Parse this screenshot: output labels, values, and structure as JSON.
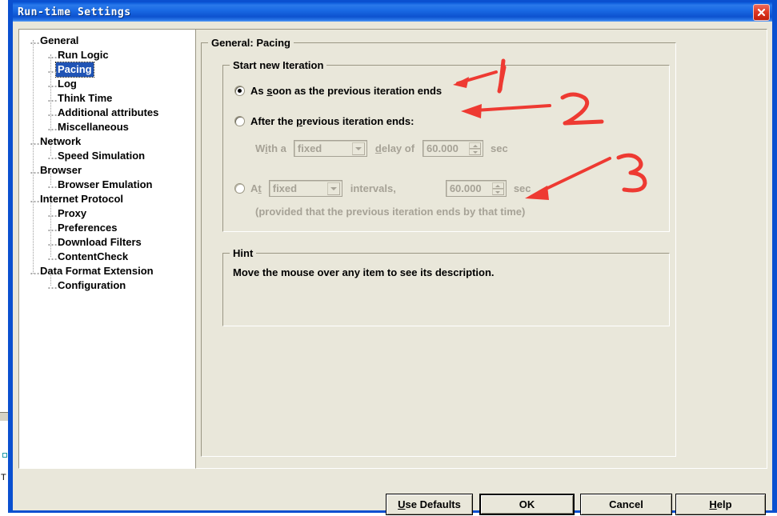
{
  "window": {
    "title": "Run-time Settings",
    "close_icon": "close-icon",
    "accent_color": "#0a50d0",
    "face_color": "#e9e7da"
  },
  "tree": {
    "selected": "Pacing",
    "items": [
      {
        "label": "General",
        "level": 0
      },
      {
        "label": "Run Logic",
        "level": 1
      },
      {
        "label": "Pacing",
        "level": 1,
        "selected": true
      },
      {
        "label": "Log",
        "level": 1
      },
      {
        "label": "Think Time",
        "level": 1
      },
      {
        "label": "Additional attributes",
        "level": 1
      },
      {
        "label": "Miscellaneous",
        "level": 1
      },
      {
        "label": "Network",
        "level": 0
      },
      {
        "label": "Speed Simulation",
        "level": 1
      },
      {
        "label": "Browser",
        "level": 0
      },
      {
        "label": "Browser Emulation",
        "level": 1
      },
      {
        "label": "Internet Protocol",
        "level": 0
      },
      {
        "label": "Proxy",
        "level": 1
      },
      {
        "label": "Preferences",
        "level": 1
      },
      {
        "label": "Download Filters",
        "level": 1
      },
      {
        "label": "ContentCheck",
        "level": 1
      },
      {
        "label": "Data Format Extension",
        "level": 0
      },
      {
        "label": "Configuration",
        "level": 1
      }
    ]
  },
  "content": {
    "page_title": "General: Pacing",
    "start_group": {
      "title": "Start new Iteration",
      "option1": {
        "label_before": "As ",
        "label_accel": "s",
        "label_after": "oon as the previous iteration ends",
        "checked": true,
        "enabled": true
      },
      "option2": {
        "label_before": "After the ",
        "label_accel": "p",
        "label_after": "revious iteration ends:",
        "checked": false,
        "enabled": true,
        "sub": {
          "with_a_before": "W",
          "with_a_accel": "i",
          "with_a_after": "th a",
          "combo_value": "fixed",
          "delay_before": "",
          "delay_accel": "d",
          "delay_after": "elay of",
          "spin_value": "60.000",
          "unit": "sec",
          "enabled": false
        }
      },
      "option3": {
        "label_before": "A",
        "label_accel": "t",
        "label_after": "",
        "checked": false,
        "enabled": false,
        "combo_value": "fixed",
        "intervals_label": "intervals,",
        "spin_value": "60.000",
        "unit": "sec",
        "note": "(provided that the previous iteration ends by that time)"
      }
    },
    "hint_group": {
      "title": "Hint",
      "text": "Move the mouse over any item to see its description."
    }
  },
  "buttons": {
    "use_defaults": {
      "before": "",
      "accel": "U",
      "after": "se Defaults"
    },
    "ok": {
      "label": "OK",
      "is_default": true
    },
    "cancel": {
      "label": "Cancel"
    },
    "help": {
      "before": "",
      "accel": "H",
      "after": "elp"
    }
  },
  "annotations": {
    "marks": [
      {
        "number": "1",
        "target": "As soon as the previous iteration ends"
      },
      {
        "number": "2",
        "target": "After the previous iteration ends:"
      },
      {
        "number": "3",
        "target": "At fixed intervals"
      }
    ],
    "color": "#ee3a32"
  }
}
